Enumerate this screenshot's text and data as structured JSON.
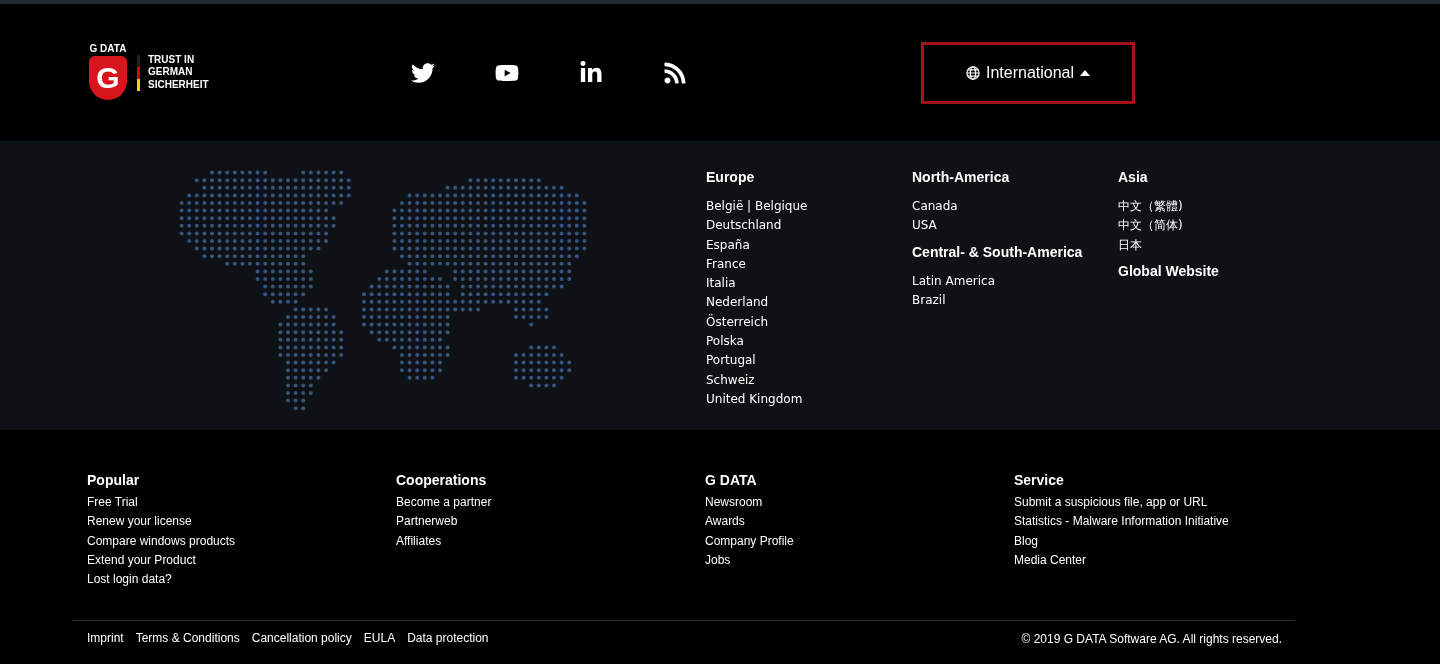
{
  "logo": {
    "brand": "G DATA",
    "letter": "G",
    "tagline": [
      "TRUST IN",
      "GERMAN",
      "SICHERHEIT"
    ]
  },
  "social": [
    {
      "kind": "twitter"
    },
    {
      "kind": "youtube"
    },
    {
      "kind": "linkedin"
    },
    {
      "kind": "rss"
    }
  ],
  "language_selector": {
    "label": "International",
    "expanded": true
  },
  "regions": [
    {
      "title": "Europe",
      "items": [
        "België | Belgique",
        "Deutschland",
        "España",
        "France",
        "Italia",
        "Nederland",
        "Österreich",
        "Polska",
        "Portugal",
        "Schweiz",
        "United Kingdom"
      ]
    },
    {
      "groups": [
        {
          "title": "North-America",
          "items": [
            "Canada",
            "USA"
          ]
        },
        {
          "title": "Central- & South-America",
          "items": [
            "Latin America",
            "Brazil"
          ]
        }
      ]
    },
    {
      "groups": [
        {
          "title": "Asia",
          "items": [
            "中文（繁體)",
            "中文（简体)",
            "日本"
          ]
        },
        {
          "title": "Global Website"
        }
      ]
    }
  ],
  "link_columns": [
    {
      "title": "Popular",
      "items": [
        "Free Trial",
        "Renew your license",
        "Compare windows products",
        "Extend your Product",
        "Lost login data?"
      ]
    },
    {
      "title": "Cooperations",
      "items": [
        "Become a partner",
        "Partnerweb",
        "Affiliates"
      ]
    },
    {
      "title": "G DATA",
      "items": [
        "Newsroom",
        "Awards",
        "Company Profile",
        "Jobs"
      ]
    },
    {
      "title": "Service",
      "items": [
        "Submit a suspicious file, app or URL",
        "Statistics - Malware Information Initiative",
        "Blog",
        "Media Center"
      ]
    }
  ],
  "legal_links": [
    "Imprint",
    "Terms & Conditions",
    "Cancellation policy",
    "EULA",
    "Data protection"
  ],
  "copyright": "© 2019 G DATA Software AG. All rights reserved."
}
